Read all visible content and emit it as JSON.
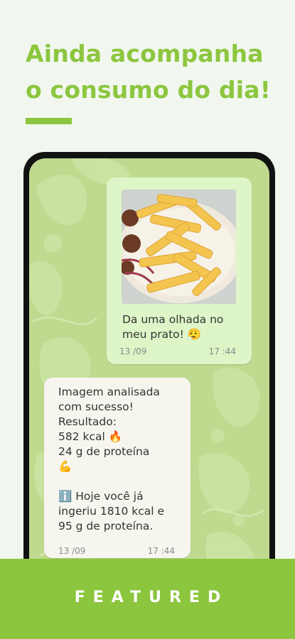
{
  "headline": {
    "line1": "Ainda acompanha",
    "line2": "o consumo do dia!"
  },
  "chat": {
    "outgoing": {
      "image": "fries-and-meat-plate-photo",
      "text": "Da uma olhada no\nmeu prato! 😮‍💨",
      "date": "13 /09",
      "time": "17 :44"
    },
    "incoming": {
      "text": "Imagem analisada\ncom sucesso!\nResultado:\n582 kcal 🔥\n24 g de proteína\n💪\n\nℹ️ Hoje você já\ningeriu 1810 kcal e\n95 g de proteína.",
      "date": "13 /09",
      "time": "17 :44"
    }
  },
  "footer": {
    "label": "FEATURED"
  },
  "colors": {
    "brand_green": "#8cc63f",
    "page_background": "#f1f7ee",
    "chat_wallpaper": "#bfd98f",
    "outgoing_bubble": "#ddf5c7",
    "incoming_bubble": "#f6f6ef",
    "phone_frame": "#121212"
  }
}
